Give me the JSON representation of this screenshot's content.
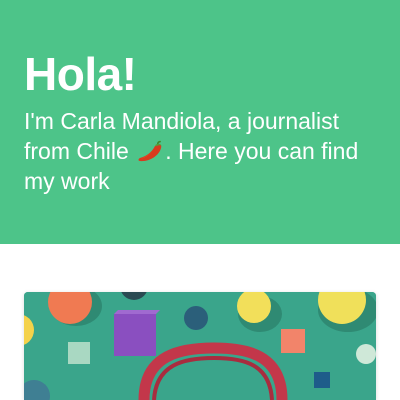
{
  "hero": {
    "title": "Hola!",
    "intro_before": "I'm Carla Mandiola, a journalist from Chile",
    "intro_after": ". Here you can find my work",
    "emoji_icon": "chili-pepper-icon",
    "background": "#4dc489",
    "text_color": "#ffffff"
  },
  "work_card": {
    "image_icon": "colorful-shapes-headphones-illustration",
    "background": "#3aa58b"
  }
}
